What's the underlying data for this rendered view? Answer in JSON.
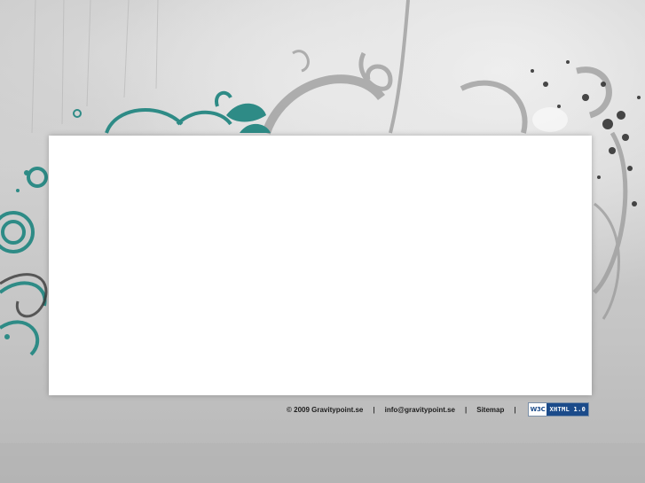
{
  "footer": {
    "copyright": "© 2009 Gravitypoint.se",
    "separator": "|",
    "email": "info@gravitypoint.se",
    "sitemap": "Sitemap",
    "badge": {
      "logo": "W3C",
      "label": "XHTML 1.0"
    }
  },
  "colors": {
    "background": "#c4c4c4",
    "panel": "#ffffff",
    "teal_accent": "#2e8b86",
    "footer_text": "#1e1e1e",
    "badge_blue": "#1b4b8a"
  },
  "icons": [
    "w3c-xhtml-badge-icon"
  ]
}
